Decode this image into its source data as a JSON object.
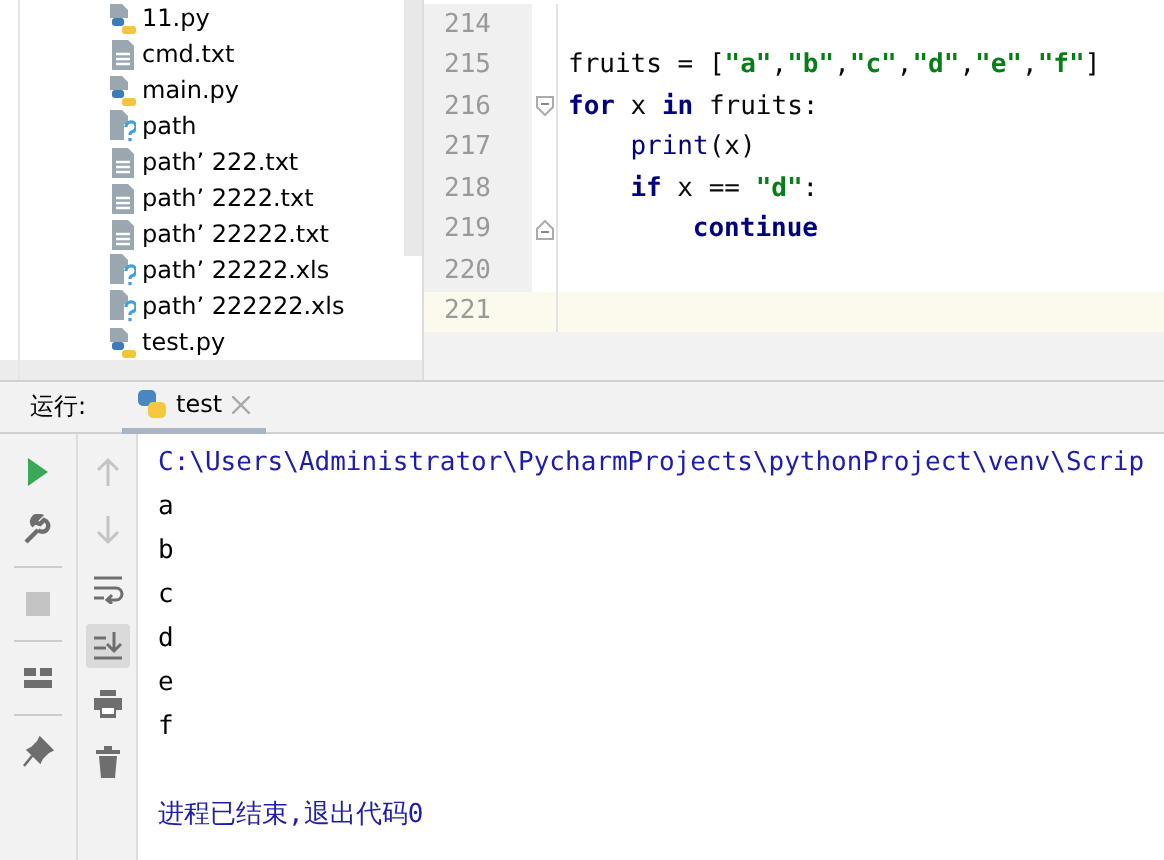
{
  "project_tree": {
    "items": [
      {
        "name": "11.py",
        "kind": "python"
      },
      {
        "name": "cmd.txt",
        "kind": "text"
      },
      {
        "name": "main.py",
        "kind": "python"
      },
      {
        "name": "path",
        "kind": "unknown"
      },
      {
        "name": "path’ 222.txt",
        "kind": "text"
      },
      {
        "name": "path’ 2222.txt",
        "kind": "text"
      },
      {
        "name": "path’ 22222.txt",
        "kind": "text"
      },
      {
        "name": "path’ 22222.xls",
        "kind": "unknown"
      },
      {
        "name": "path’ 222222.xls",
        "kind": "unknown"
      },
      {
        "name": "test.py",
        "kind": "python"
      }
    ]
  },
  "editor": {
    "lines": [
      {
        "number": "214",
        "current": false
      },
      {
        "number": "215",
        "current": false,
        "tokens": [
          {
            "text": "fruits = [",
            "kind": "plain"
          },
          {
            "text": "\"a\"",
            "kind": "string"
          },
          {
            "text": ",",
            "kind": "plain"
          },
          {
            "text": "\"b\"",
            "kind": "string"
          },
          {
            "text": ",",
            "kind": "plain"
          },
          {
            "text": "\"c\"",
            "kind": "string"
          },
          {
            "text": ",",
            "kind": "plain"
          },
          {
            "text": "\"d\"",
            "kind": "string"
          },
          {
            "text": ",",
            "kind": "plain"
          },
          {
            "text": "\"e\"",
            "kind": "string"
          },
          {
            "text": ",",
            "kind": "plain"
          },
          {
            "text": "\"f\"",
            "kind": "string"
          },
          {
            "text": "]",
            "kind": "plain"
          }
        ]
      },
      {
        "number": "216",
        "current": false,
        "tokens": [
          {
            "text": "for",
            "kind": "keyword"
          },
          {
            "text": " x ",
            "kind": "plain"
          },
          {
            "text": "in",
            "kind": "keyword"
          },
          {
            "text": " fruits:",
            "kind": "plain"
          }
        ],
        "children": [
          {
            "number": "217",
            "current": false,
            "tokens": [
              {
                "text": "print",
                "kind": "builtin"
              },
              {
                "text": "(x)",
                "kind": "plain"
              }
            ]
          },
          {
            "number": "218",
            "current": false,
            "tokens": [
              {
                "text": "if",
                "kind": "keyword"
              },
              {
                "text": " x == ",
                "kind": "plain"
              },
              {
                "text": "\"d\"",
                "kind": "string"
              },
              {
                "text": ":",
                "kind": "plain"
              }
            ],
            "children": [
              {
                "number": "219",
                "current": false,
                "tokens": [
                  {
                    "text": "continue",
                    "kind": "keyword"
                  }
                ]
              }
            ]
          }
        ]
      },
      {
        "number": "220",
        "current": false
      },
      {
        "number": "221",
        "current": true
      }
    ]
  },
  "run_panel": {
    "label": "运行:",
    "tabs": [
      {
        "label": "test",
        "selected": true
      }
    ],
    "toolbar_left": [
      {
        "disabled": false
      },
      {
        "disabled": false
      },
      {
        "disabled": true
      },
      {
        "disabled": false
      },
      {
        "disabled": false
      }
    ],
    "toolbar_right": [
      {
        "disabled": true,
        "selected": false
      },
      {
        "disabled": true,
        "selected": false
      },
      {
        "disabled": false,
        "selected": false
      },
      {
        "disabled": false,
        "selected": true
      },
      {
        "disabled": false,
        "selected": false
      },
      {
        "disabled": false,
        "selected": false
      }
    ],
    "console": [
      {
        "text": "C:\\Users\\Administrator\\PycharmProjects\\pythonProject\\venv\\Scrip",
        "kind": "command"
      },
      {
        "text": "a",
        "kind": "output"
      },
      {
        "text": "b",
        "kind": "output"
      },
      {
        "text": "c",
        "kind": "output"
      },
      {
        "text": "d",
        "kind": "output"
      },
      {
        "text": "e",
        "kind": "output"
      },
      {
        "text": "f",
        "kind": "output"
      },
      {
        "text": "进程已结束,退出代码0",
        "kind": "exit"
      }
    ]
  }
}
